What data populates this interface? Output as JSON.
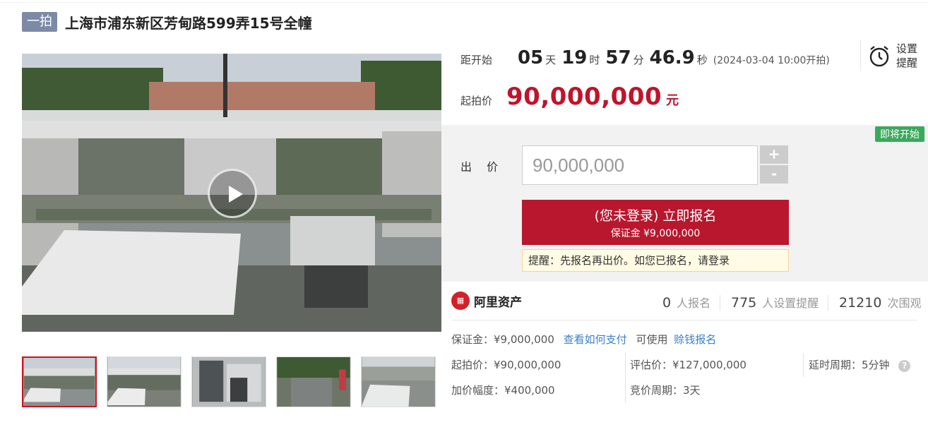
{
  "header": {
    "tag": "一拍",
    "title": "上海市浦东新区芳甸路599弄15号全幢"
  },
  "countdown": {
    "label": "距开始",
    "days": "05",
    "days_unit": "天",
    "hours": "19",
    "hours_unit": "时",
    "minutes": "57",
    "minutes_unit": "分",
    "seconds": "46.9",
    "seconds_unit": "秒",
    "start_time": "(2024-03-04 10:00开拍)"
  },
  "reminder": {
    "icon": "alarm-clock-icon",
    "label": "设置提醒"
  },
  "starting_price": {
    "label": "起拍价",
    "value": "90,000,000",
    "unit": "元"
  },
  "bid": {
    "status_badge": "即将开始",
    "label": "出 价",
    "input_value": "90,000,000",
    "plus": "+",
    "minus": "-",
    "signup_main": "(您未登录) 立即报名",
    "signup_sub": "保证金 ¥9,000,000",
    "tip": "提醒：先报名再出价。如您已报名，请登录"
  },
  "stats": {
    "brand": "阿里资产",
    "registered_num": "0",
    "registered_label": "人报名",
    "reminder_num": "775",
    "reminder_label": "人设置提醒",
    "views_num": "21210",
    "views_label": "次围观"
  },
  "details": {
    "deposit": "保证金：¥9,000,000",
    "how_to_pay": "查看如何支付",
    "usable": "可使用",
    "earn_signup": "赊钱报名",
    "start_price": "起拍价：¥90,000,000",
    "increment": "加价幅度：¥400,000",
    "appraisal": "评估价：¥127,000,000",
    "auction_period": "竞价周期：3天",
    "delay_period": "延时周期：5分钟",
    "help": "?"
  },
  "colors": {
    "accent": "#b8172d",
    "price": "#c0142c",
    "link": "#3c7fc8",
    "badge_green": "#3aa95b"
  }
}
